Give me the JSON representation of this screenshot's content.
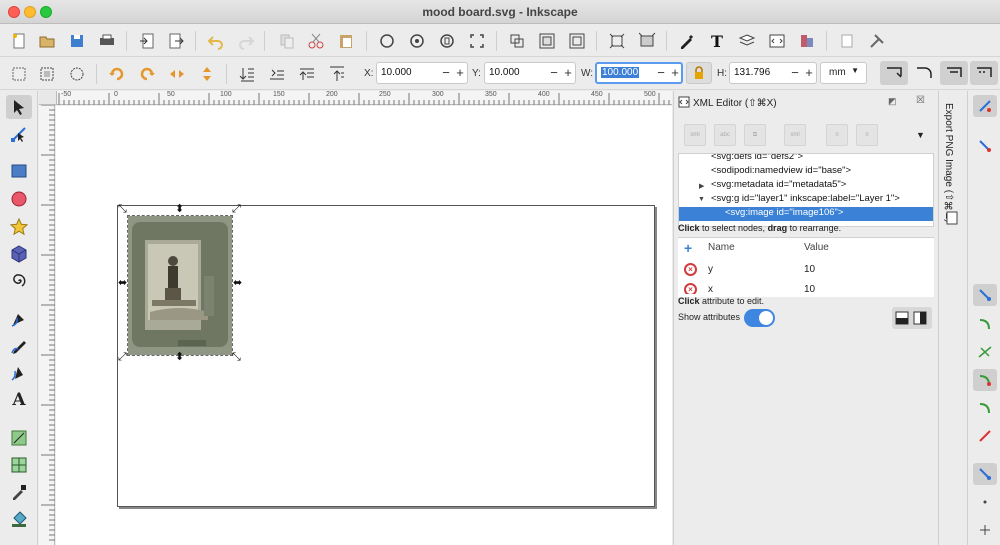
{
  "window": {
    "title": "mood board.svg - Inkscape"
  },
  "controls": {
    "x_label": "X:",
    "x_value": "10.000",
    "y_label": "Y:",
    "y_value": "10.000",
    "w_label": "W:",
    "w_value": "100.000",
    "h_label": "H:",
    "h_value": "131.796",
    "unit": "mm",
    "minus": "−",
    "plus": "+"
  },
  "ruler": {
    "labels": [
      "-50",
      "0",
      "50",
      "100",
      "150",
      "200",
      "250",
      "300",
      "350",
      "400",
      "450",
      "500"
    ]
  },
  "xml_editor": {
    "title": "XML Editor (⇧⌘X)",
    "nodes": [
      "<svg:defs id=\"defs2\">",
      "<sodipodi:namedview id=\"base\">",
      "<svg:metadata id=\"metadata5\">",
      "<svg:g id=\"layer1\" inkscape:label=\"Layer 1\">",
      "<svg:image id=\"image106\">"
    ],
    "node_hint_click": "Click",
    "node_hint_mid": " to select nodes, ",
    "node_hint_drag": "drag",
    "node_hint_end": " to rearrange.",
    "attr_header_name": "Name",
    "attr_header_value": "Value",
    "attributes": [
      {
        "name": "y",
        "value": "10"
      },
      {
        "name": "x",
        "value": "10"
      }
    ],
    "attr_hint_click": "Click",
    "attr_hint_end": " attribute to edit.",
    "show_attributes_label": "Show attributes",
    "show_attributes_on": true
  },
  "export_tab": {
    "label": "Export PNG Image (⇧⌘E)"
  },
  "colors": {
    "accent": "#3b82d6",
    "close": "#fe5f57",
    "minimize": "#febc2e",
    "maximize": "#28c840"
  }
}
